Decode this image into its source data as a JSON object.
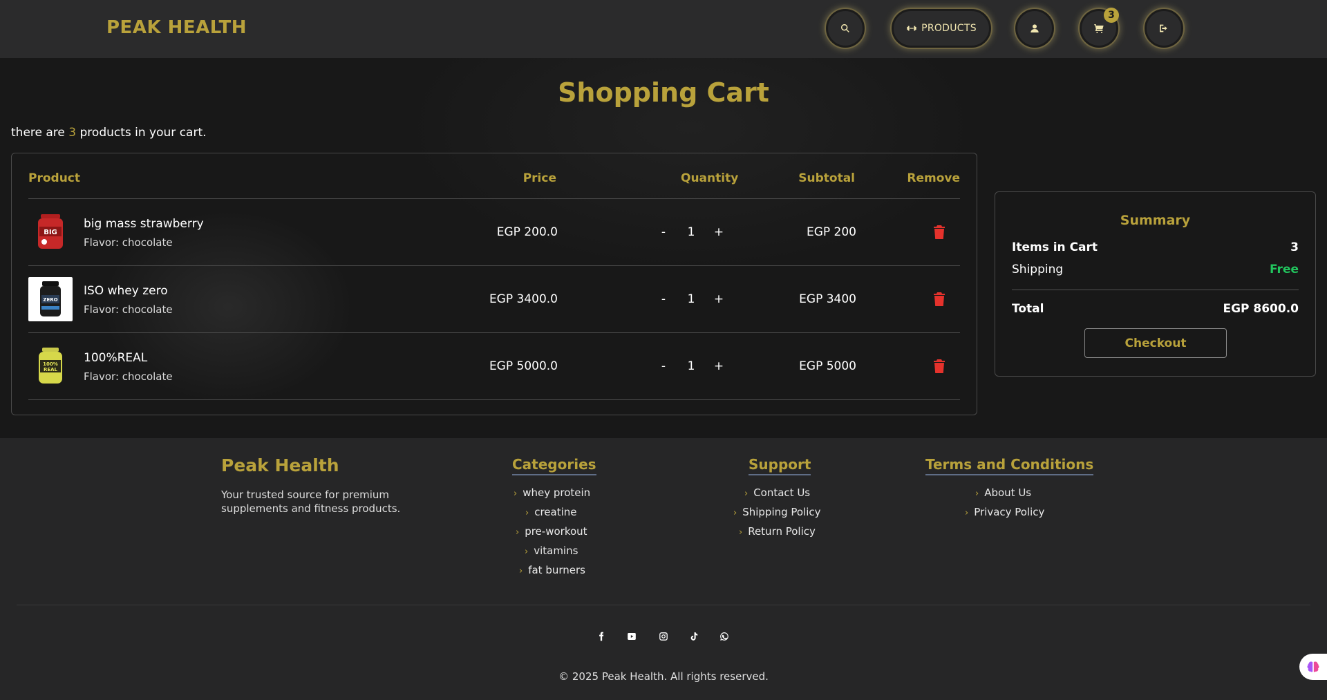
{
  "header": {
    "brand": "PEAK HEALTH",
    "products_label": "PRODUCTS",
    "cart_count": "3",
    "icons": [
      "search-icon",
      "dumbbell-icon",
      "user-icon",
      "cart-icon",
      "logout-icon"
    ]
  },
  "main": {
    "title": "Shopping Cart",
    "count_prefix": "there are ",
    "count_value": "3",
    "count_suffix": " products in your cart.",
    "table": {
      "headers": {
        "product": "Product",
        "price": "Price",
        "quantity": "Quantity",
        "subtotal": "Subtotal",
        "remove": "Remove"
      },
      "rows": [
        {
          "name": "big mass strawberry",
          "flavor": "Flavor: chocolate",
          "price": "EGP 200.0",
          "minus": "-",
          "qty": "1",
          "plus": "+",
          "subtotal": "EGP 200"
        },
        {
          "name": "ISO whey zero",
          "flavor": "Flavor: chocolate",
          "price": "EGP 3400.0",
          "minus": "-",
          "qty": "1",
          "plus": "+",
          "subtotal": "EGP 3400"
        },
        {
          "name": "100%REAL",
          "flavor": "Flavor: chocolate",
          "price": "EGP 5000.0",
          "minus": "-",
          "qty": "1",
          "plus": "+",
          "subtotal": "EGP 5000"
        }
      ]
    }
  },
  "summary": {
    "title": "Summary",
    "items_label": "Items in Cart",
    "items_value": "3",
    "shipping_label": "Shipping",
    "shipping_value": "Free",
    "total_label": "Total",
    "total_value": "EGP 8600.0",
    "checkout_label": "Checkout"
  },
  "footer": {
    "brand": "Peak Health",
    "description": "Your trusted source for premium supplements and fitness products.",
    "categories": {
      "title": "Categories",
      "items": [
        "whey protein",
        "creatine",
        "pre-workout",
        "vitamins",
        "fat burners"
      ]
    },
    "support": {
      "title": "Support",
      "items": [
        "Contact Us",
        "Shipping Policy",
        "Return Policy"
      ]
    },
    "terms": {
      "title": "Terms and Conditions",
      "items": [
        "About Us",
        "Privacy Policy"
      ]
    },
    "chevron": "›",
    "social": [
      "facebook-icon",
      "youtube-icon",
      "instagram-icon",
      "tiktok-icon",
      "whatsapp-icon"
    ],
    "copyright": "© 2025 Peak Health. All rights reserved."
  },
  "colors": {
    "accent": "#b9a23b",
    "danger": "#e5322c",
    "success": "#22c55e",
    "header_bg": "#2b2b2c",
    "main_bg": "#181818"
  }
}
